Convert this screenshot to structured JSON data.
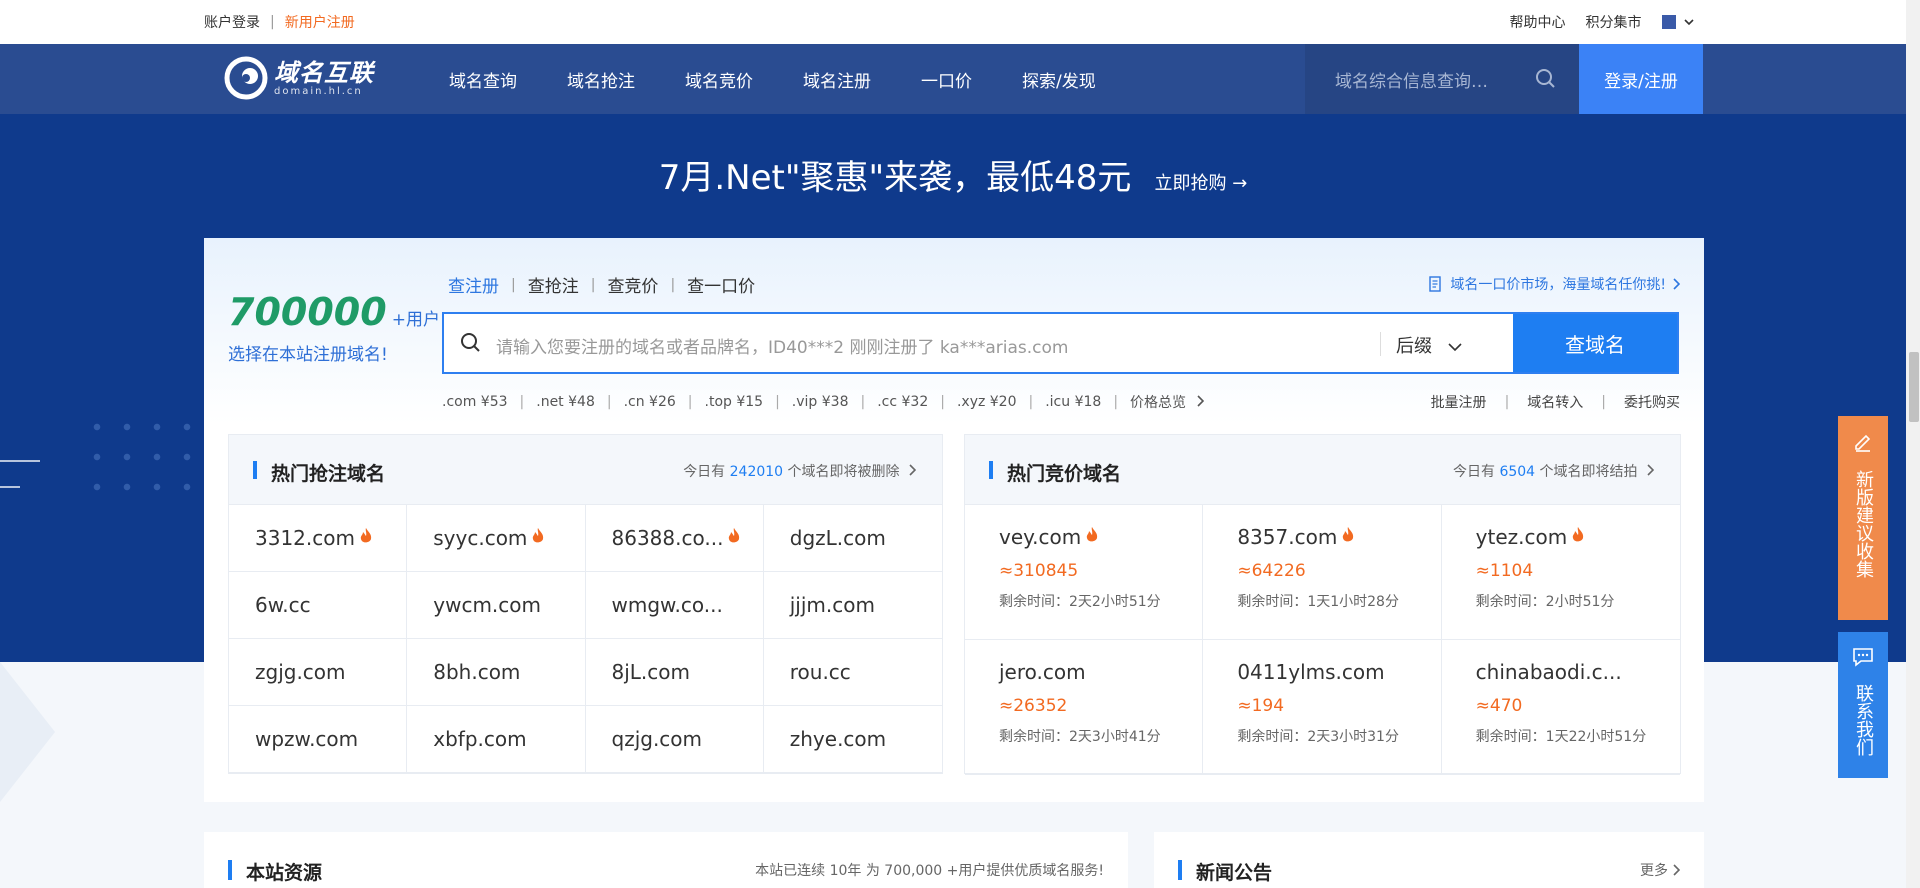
{
  "topbar": {
    "login": "账户登录",
    "sep": "|",
    "register": "新用户注册",
    "help": "帮助中心",
    "points": "积分集市"
  },
  "logo": {
    "name": "域名互联",
    "sub": "domain.hl.cn"
  },
  "nav": {
    "items": [
      "域名查询",
      "域名抢注",
      "域名竞价",
      "域名注册",
      "一口价",
      "探索/发现"
    ],
    "search_placeholder": "域名综合信息查询…",
    "login_button": "登录/注册"
  },
  "banner": {
    "title": "7月.Net\"聚惠\"来袭，最低48元",
    "link": "立即抢购 →"
  },
  "stats": {
    "users": "700000",
    "users_unit": "+用户",
    "slogan": "选择在本站注册域名!"
  },
  "search": {
    "tabs": [
      "查注册",
      "查抢注",
      "查竞价",
      "查一口价"
    ],
    "tab_sep": "|",
    "market_link": "域名一口价市场，海量域名任你挑!",
    "placeholder": "请输入您要注册的域名或者品牌名，ID40***2 刚刚注册了 ka***arias.com",
    "suffix": "后缀",
    "button": "查域名",
    "prices": [
      ".com ¥53",
      ".net ¥48",
      ".cn ¥26",
      ".top ¥15",
      ".vip ¥38",
      ".cc ¥32",
      ".xyz ¥20",
      ".icu ¥18"
    ],
    "price_sep": "|",
    "price_overview": "价格总览",
    "quick_links": [
      "批量注册",
      "域名转入",
      "委托购买"
    ]
  },
  "hot_register": {
    "title": "热门抢注域名",
    "info_pre": "今日有",
    "info_count": "242010",
    "info_post": "个域名即将被删除",
    "domains": [
      "3312.com",
      "syyc.com",
      "86388.co...",
      "dgzL.com",
      "6w.cc",
      "ywcm.com",
      "wmgw.co...",
      "jjjm.com",
      "zgjg.com",
      "8bh.com",
      "8jL.com",
      "rou.cc",
      "wpzw.com",
      "xbfp.com",
      "qzjg.com",
      "zhye.com"
    ],
    "hot_flags": [
      true,
      true,
      true,
      false,
      false,
      false,
      false,
      false,
      false,
      false,
      false,
      false,
      false,
      false,
      false,
      false
    ]
  },
  "hot_auction": {
    "title": "热门竞价域名",
    "info_pre": "今日有",
    "info_count": "6504",
    "info_post": "个域名即将结拍",
    "items": [
      {
        "domain": "vey.com",
        "price": "≈310845",
        "time": "剩余时间：2天2小时51分",
        "hot": true
      },
      {
        "domain": "8357.com",
        "price": "≈64226",
        "time": "剩余时间：1天1小时28分",
        "hot": true
      },
      {
        "domain": "ytez.com",
        "price": "≈1104",
        "time": "剩余时间：2小时51分",
        "hot": true
      },
      {
        "domain": "jero.com",
        "price": "≈26352",
        "time": "剩余时间：2天3小时41分",
        "hot": false
      },
      {
        "domain": "0411ylms.com",
        "price": "≈194",
        "time": "剩余时间：2天3小时31分",
        "hot": false
      },
      {
        "domain": "chinabaodi.c...",
        "price": "≈470",
        "time": "剩余时间：1天22小时51分",
        "hot": false
      }
    ]
  },
  "resources": {
    "title": "本站资源",
    "info": "本站已连续 10年 为 700,000 +用户提供优质域名服务!"
  },
  "news": {
    "title": "新闻公告",
    "more": "更多"
  },
  "side": {
    "feedback": "新版建议收集",
    "contact": "联系我们"
  },
  "colors": {
    "nav": "#2a4c91",
    "banner": "#0f3a8c",
    "accent": "#1e7ef2",
    "orange": "#f26a21",
    "green": "#1f9b67"
  }
}
